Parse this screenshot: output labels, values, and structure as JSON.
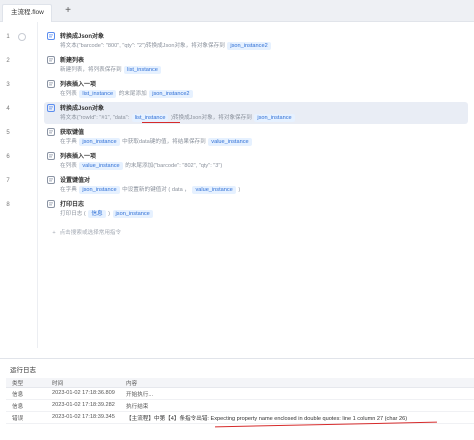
{
  "tabs": [
    {
      "label": "主流程.flow"
    }
  ],
  "tab_add": "+",
  "line_numbers": [
    "1",
    "2",
    "3",
    "4",
    "5",
    "6",
    "7",
    "8"
  ],
  "steps": [
    {
      "title": "转换成Json对象",
      "desc": [
        {
          "t": "将文本("
        },
        {
          "t": "\"barcode\": \"800\", \"qty\": \"2\""
        },
        {
          "t": ")转换成Json对象，将对象保存到 "
        },
        {
          "chip": "json_instance2"
        }
      ],
      "icon": "json-icon",
      "color": "#5b8def"
    },
    {
      "title": "新建列表",
      "desc": [
        {
          "t": "新建列表，将列表保存到 "
        },
        {
          "chip": "list_instance"
        }
      ],
      "icon": "list-icon",
      "color": "#8a93a3"
    },
    {
      "title": "列表插入一项",
      "desc": [
        {
          "t": "在列表 "
        },
        {
          "chip": "list_instance"
        },
        {
          "t": " 的末尾添加 "
        },
        {
          "chip": "json_instance2"
        }
      ],
      "icon": "list-insert-icon",
      "color": "#8a93a3"
    },
    {
      "title": "转换成Json对象",
      "desc": [
        {
          "t": "将文本(\"rowId\": \"#1\", \"data\": "
        },
        {
          "chip": "list_instance"
        },
        {
          "t": " )转换成Json对象，将对象保存到 "
        },
        {
          "chip": "json_instance"
        }
      ],
      "icon": "json-icon",
      "color": "#5b8def"
    },
    {
      "title": "获取键值",
      "desc": [
        {
          "t": "在字典 "
        },
        {
          "chip": "json_instance"
        },
        {
          "t": " 中获取data键的值，将结果保存到 "
        },
        {
          "chip": "value_instance"
        }
      ],
      "icon": "key-icon",
      "color": "#8a93a3"
    },
    {
      "title": "列表插入一项",
      "desc": [
        {
          "t": "在列表 "
        },
        {
          "chip": "value_instance"
        },
        {
          "t": " 的末尾添加(\"barcode\": \"802\", \"qty\": \"3\")"
        }
      ],
      "icon": "list-insert-icon",
      "color": "#8a93a3"
    },
    {
      "title": "设置键值对",
      "desc": [
        {
          "t": "在字典 "
        },
        {
          "chip": "json_instance"
        },
        {
          "t": " 中设置新的键值对 ( data ， "
        },
        {
          "chip": "value_instance"
        },
        {
          "t": " )"
        }
      ],
      "icon": "keyvalue-icon",
      "color": "#8a93a3"
    },
    {
      "title": "打印日志",
      "desc": [
        {
          "t": "打印日志 ( "
        },
        {
          "chip": "信息"
        },
        {
          "t": " ) "
        },
        {
          "chip": "json_instance"
        }
      ],
      "icon": "print-icon",
      "color": "#8a93a3"
    }
  ],
  "hint": "点击搜索或选择常用指令",
  "log": {
    "title": "运行日志",
    "headers": [
      "类型",
      "时间",
      "内容"
    ],
    "rows": [
      {
        "type": "信息",
        "time": "2023-01-02 17:18:36.809",
        "content": "开始执行..."
      },
      {
        "type": "信息",
        "time": "2023-01-02 17:18:39.282",
        "content": "执行结束"
      },
      {
        "type": "错误",
        "time": "2023-01-02 17:18:39.345",
        "content": "【主流程】中第【4】条指令出错:  Expecting property name enclosed in double quotes: line 1 column 27 (char 26)"
      }
    ]
  },
  "colors": {
    "accent": "#2f6fd6",
    "error_underline": "#d62b2b",
    "selected_row": "#e9edf5"
  }
}
